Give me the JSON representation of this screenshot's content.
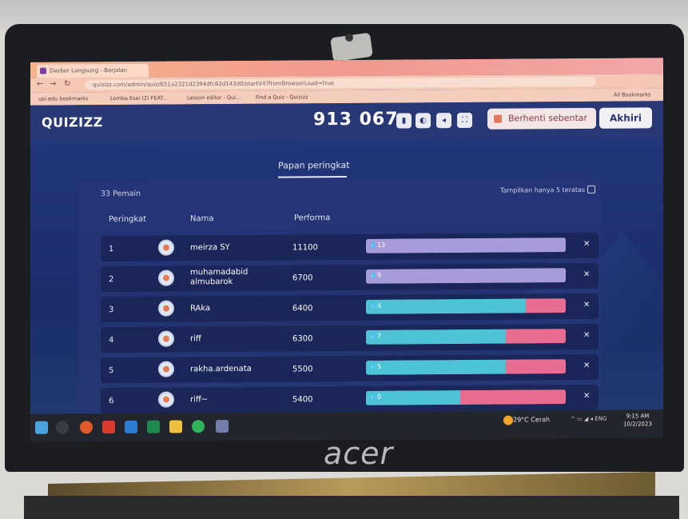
{
  "browser": {
    "tab_title": "Dasbor Langsung - Berjalan",
    "url": "quizizz.com/admin/quiz/651a2321d2394dfc62d143d0/startV4?fromBrowserLoad=true",
    "bookmarks": [
      "upi.edu bookmarks",
      "Lomba Esai (2) FEAT...",
      "Lesson editor - Qui...",
      "Find a Quiz - Quizizz",
      "All Bookmarks"
    ]
  },
  "header": {
    "logo": "QUIZIZZ",
    "game_code": "913 067",
    "pause_label": "Berhenti sebentar",
    "end_label": "Akhiri"
  },
  "leaderboard": {
    "tab_label": "Papan peringkat",
    "player_count": "33 Pemain",
    "top5_label": "Tampilkan hanya 5 teratas",
    "columns": {
      "rank": "Peringkat",
      "name": "Nama",
      "performance": "Performa"
    },
    "rows": [
      {
        "rank": "1",
        "name": "meirza SY",
        "score": "11100",
        "streak": "13",
        "correct": 1.0,
        "wrong": 0.0
      },
      {
        "rank": "2",
        "name": "muhamadabid almubarok",
        "score": "6700",
        "streak": "9",
        "correct": 1.0,
        "wrong": 0.0
      },
      {
        "rank": "3",
        "name": "RAka",
        "score": "6400",
        "streak": "4",
        "correct": 0.8,
        "wrong": 0.2
      },
      {
        "rank": "4",
        "name": "riff",
        "score": "6300",
        "streak": "7",
        "correct": 0.7,
        "wrong": 0.3
      },
      {
        "rank": "5",
        "name": "rakha.ardenata",
        "score": "5500",
        "streak": "5",
        "correct": 0.7,
        "wrong": 0.3
      },
      {
        "rank": "6",
        "name": "riff~",
        "score": "5400",
        "streak": "0",
        "correct": 0.47,
        "wrong": 0.53
      }
    ]
  },
  "taskbar": {
    "weather": "29°C Cerah",
    "lang": "ENG",
    "time": "9:15 AM",
    "date": "10/2/2023"
  },
  "laptop": {
    "brand": "acer"
  },
  "colors": {
    "correct_purple": "#a79bd9",
    "correct_teal": "#4fc3d6",
    "wrong_pink": "#e96d90",
    "header": "#283876"
  }
}
